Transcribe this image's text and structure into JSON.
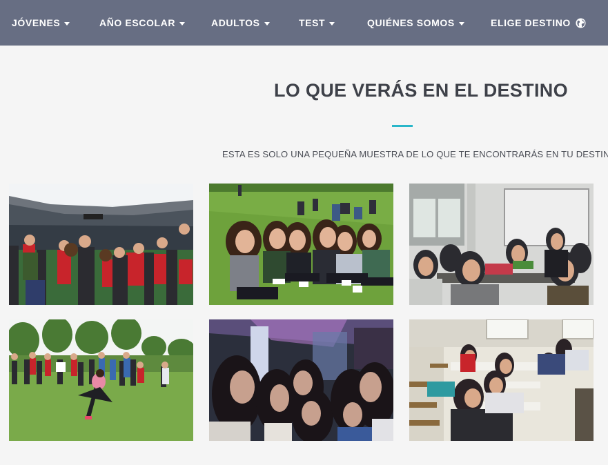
{
  "nav": {
    "items": [
      {
        "label": "JÓVENES",
        "has_dropdown": true
      },
      {
        "label": "AÑO ESCOLAR",
        "has_dropdown": true
      },
      {
        "label": "ADULTOS",
        "has_dropdown": true
      },
      {
        "label": "TEST",
        "has_dropdown": true
      },
      {
        "label": "QUIÉNES SOMOS",
        "has_dropdown": true
      },
      {
        "label": "ELIGE DESTINO",
        "icon": "globe-icon"
      }
    ]
  },
  "section": {
    "title": "LO QUE VERÁS EN EL DESTINO",
    "subtitle": "ESTA ES SOLO UNA PEQUEÑA MUESTRA DE LO QUE TE ENCONTRARÁS EN TU DESTINO."
  },
  "gallery": [
    {
      "scene": "stadium-group"
    },
    {
      "scene": "girls-on-grass"
    },
    {
      "scene": "classroom-students"
    },
    {
      "scene": "outdoor-field-game"
    },
    {
      "scene": "night-party-selfie"
    },
    {
      "scene": "classroom-study"
    }
  ],
  "colors": {
    "nav_bg": "#676e83",
    "page_bg": "#f5f5f5",
    "title": "#3e4149",
    "accent": "#29b6c9",
    "subtitle": "#4a4d55"
  }
}
